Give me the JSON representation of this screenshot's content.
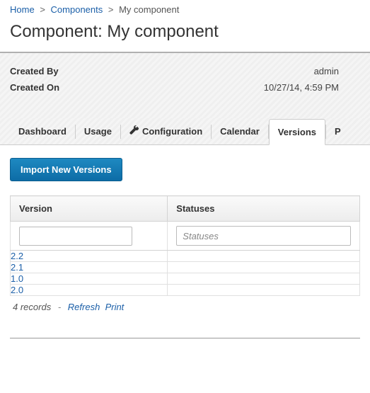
{
  "breadcrumb": {
    "home": "Home",
    "components": "Components",
    "current": "My component"
  },
  "page_title": "Component: My component",
  "meta": {
    "created_by_label": "Created By",
    "created_by_value": "admin",
    "created_on_label": "Created On",
    "created_on_value": "10/27/14, 4:59 PM"
  },
  "tabs": {
    "dashboard": "Dashboard",
    "usage": "Usage",
    "configuration": "Configuration",
    "calendar": "Calendar",
    "versions": "Versions",
    "p": "P"
  },
  "buttons": {
    "import": "Import New Versions"
  },
  "table": {
    "col_version": "Version",
    "col_statuses": "Statuses",
    "status_filter_placeholder": "Statuses",
    "rows": [
      {
        "version": "2.2"
      },
      {
        "version": "2.1"
      },
      {
        "version": "1.0"
      },
      {
        "version": "2.0"
      }
    ]
  },
  "footer": {
    "count": "4 records",
    "refresh": "Refresh",
    "print": "Print"
  }
}
